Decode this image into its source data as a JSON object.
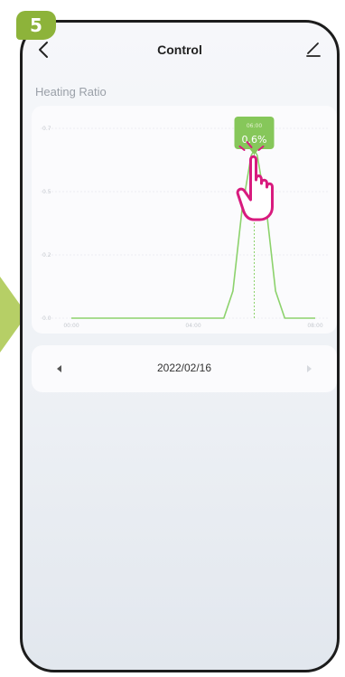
{
  "badge": {
    "number": "5"
  },
  "header": {
    "title": "Control",
    "back_icon": "chevron-left-icon",
    "edit_icon": "pencil-icon"
  },
  "section": {
    "label": "Heating Ratio"
  },
  "chart_data": {
    "type": "line",
    "title": "",
    "xlabel": "",
    "ylabel": "",
    "y_ticks": [
      "0.7",
      "0.5",
      "0.2",
      "0.0"
    ],
    "x_ticks": [
      "00:00",
      "04:00",
      "08:00"
    ],
    "xlim": [
      0,
      8
    ],
    "ylim": [
      0,
      0.7
    ],
    "grid": true,
    "series": [
      {
        "color": "#8cd26c",
        "points": [
          [
            0,
            0
          ],
          [
            5,
            0
          ],
          [
            5.3,
            0.1
          ],
          [
            5.6,
            0.4
          ],
          [
            5.9,
            0.6
          ],
          [
            6,
            0.62
          ],
          [
            6.1,
            0.6
          ],
          [
            6.4,
            0.4
          ],
          [
            6.7,
            0.1
          ],
          [
            7,
            0
          ],
          [
            8,
            0
          ]
        ]
      }
    ],
    "tooltip": {
      "time": "06:00",
      "value": "0.6%",
      "x": 6
    }
  },
  "date_nav": {
    "date": "2022/02/16",
    "prev_icon": "triangle-left-icon",
    "next_icon": "triangle-right-icon"
  },
  "colors": {
    "accent": "#8cd26c",
    "badge": "#8db33a",
    "hand": "#d81b7e"
  }
}
